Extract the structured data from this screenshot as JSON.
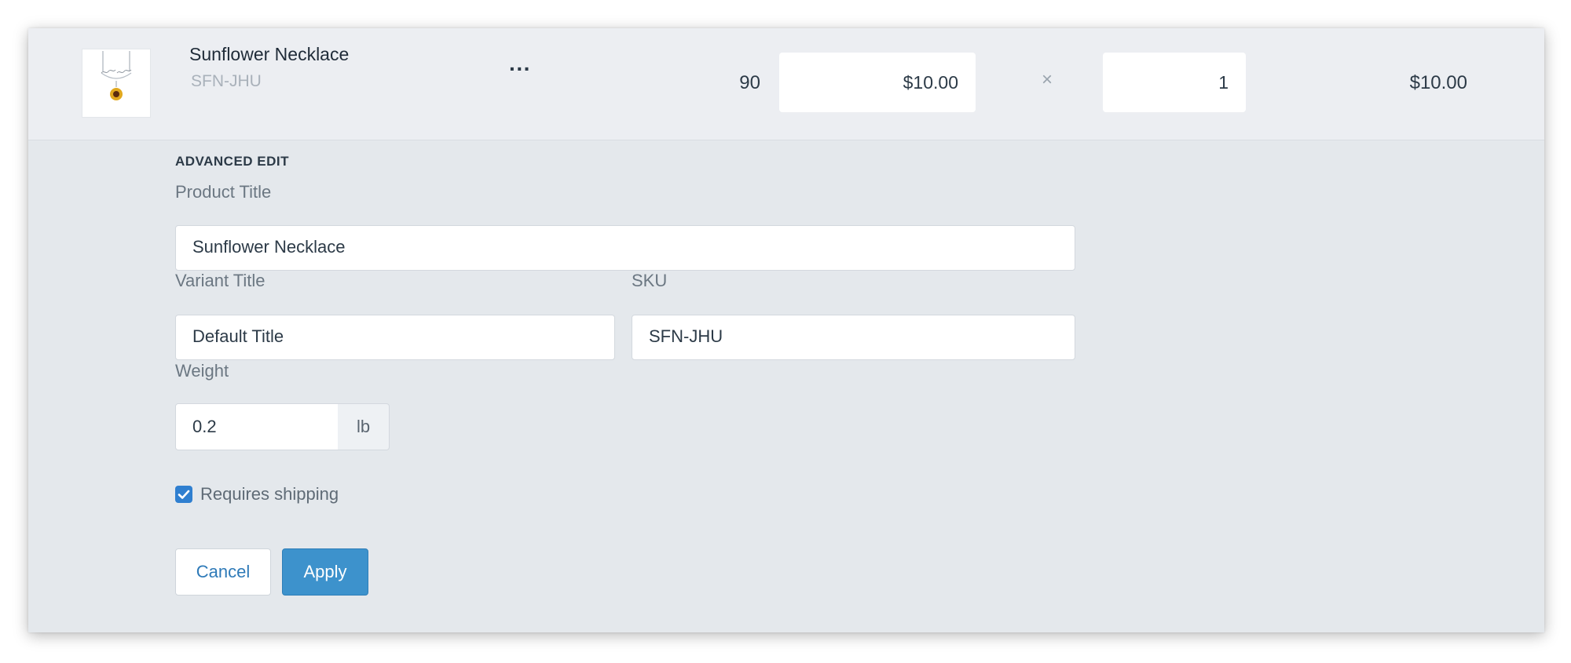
{
  "line_item": {
    "name": "Sunflower Necklace",
    "sku": "SFN-JHU",
    "more_icon": "more-horizontal-icon",
    "more_glyph": "···",
    "stock": "90",
    "price": "$10.00",
    "times_glyph": "×",
    "quantity": "1",
    "total": "$10.00"
  },
  "advanced_edit": {
    "heading": "ADVANCED EDIT",
    "product_title_label": "Product Title",
    "product_title_value": "Sunflower Necklace",
    "variant_title_label": "Variant Title",
    "variant_title_value": "Default Title",
    "sku_label": "SKU",
    "sku_value": "SFN-JHU",
    "weight_label": "Weight",
    "weight_value": "0.2",
    "weight_unit": "lb",
    "requires_shipping_label": "Requires shipping",
    "requires_shipping_checked": true,
    "cancel_label": "Cancel",
    "apply_label": "Apply"
  },
  "colors": {
    "accent": "#3d92cc",
    "checkbox": "#2f7fd0",
    "panel_bg": "#e4e8ec"
  }
}
